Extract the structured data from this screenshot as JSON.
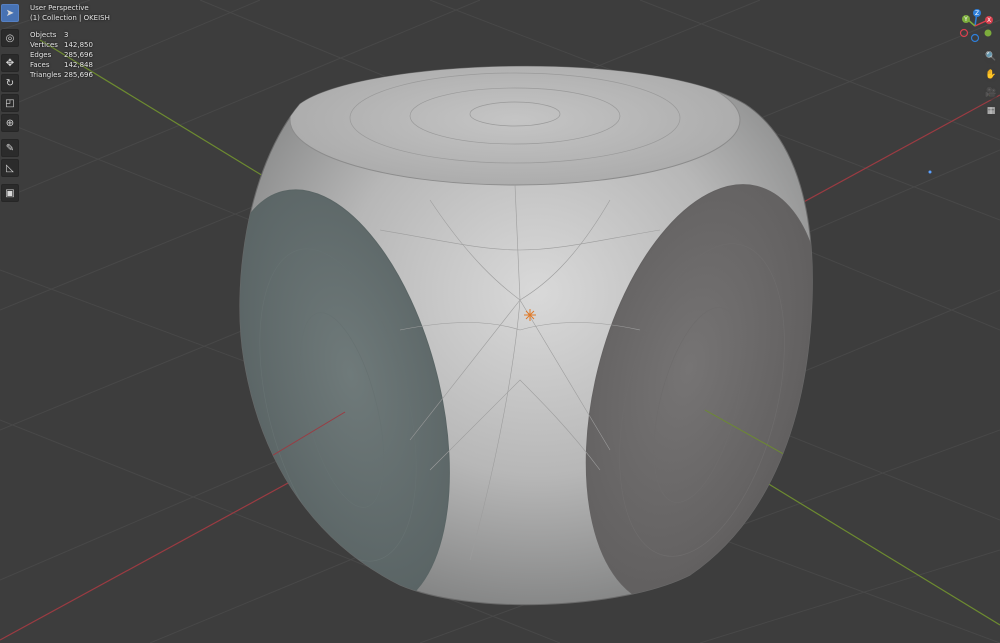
{
  "viewport": {
    "mode": "User Perspective",
    "collection": "(1) Collection | OKEISH",
    "stats": [
      {
        "label": "Objects",
        "value": "3"
      },
      {
        "label": "Vertices",
        "value": "142,850"
      },
      {
        "label": "Edges",
        "value": "285,696"
      },
      {
        "label": "Faces",
        "value": "142,848"
      },
      {
        "label": "Triangles",
        "value": "285,696"
      }
    ]
  },
  "toolbar": {
    "tools": [
      {
        "name": "select-box-tool",
        "glyph": "➤",
        "active": true
      },
      {
        "name": "cursor-tool",
        "glyph": "◎",
        "active": false
      },
      {
        "name": "move-tool",
        "glyph": "✥",
        "active": false
      },
      {
        "name": "rotate-tool",
        "glyph": "↻",
        "active": false
      },
      {
        "name": "scale-tool",
        "glyph": "◰",
        "active": false
      },
      {
        "name": "transform-tool",
        "glyph": "⊕",
        "active": false
      },
      {
        "name": "annotate-tool",
        "glyph": "✎",
        "active": false
      },
      {
        "name": "measure-tool",
        "glyph": "◺",
        "active": false
      },
      {
        "name": "add-cube-tool",
        "glyph": "▣",
        "active": false
      }
    ]
  },
  "gizmo": {
    "axes": [
      {
        "label": "Z",
        "color": "#2f7fd9"
      },
      {
        "label": "Y",
        "color": "#7cac3c"
      },
      {
        "label": "X",
        "color": "#d9404e"
      }
    ]
  },
  "nav": {
    "buttons": [
      {
        "name": "zoom-icon",
        "glyph": "🔍"
      },
      {
        "name": "pan-hand-icon",
        "glyph": "✋"
      },
      {
        "name": "camera-icon",
        "glyph": "🎥"
      },
      {
        "name": "perspective-grid-icon",
        "glyph": "▦"
      }
    ]
  },
  "colors": {
    "background": "#3d3d3d",
    "x_axis": "#9b3b42",
    "y_axis": "#6d8b30",
    "active_tool": "#4772b3",
    "origin": "#e07a28"
  }
}
